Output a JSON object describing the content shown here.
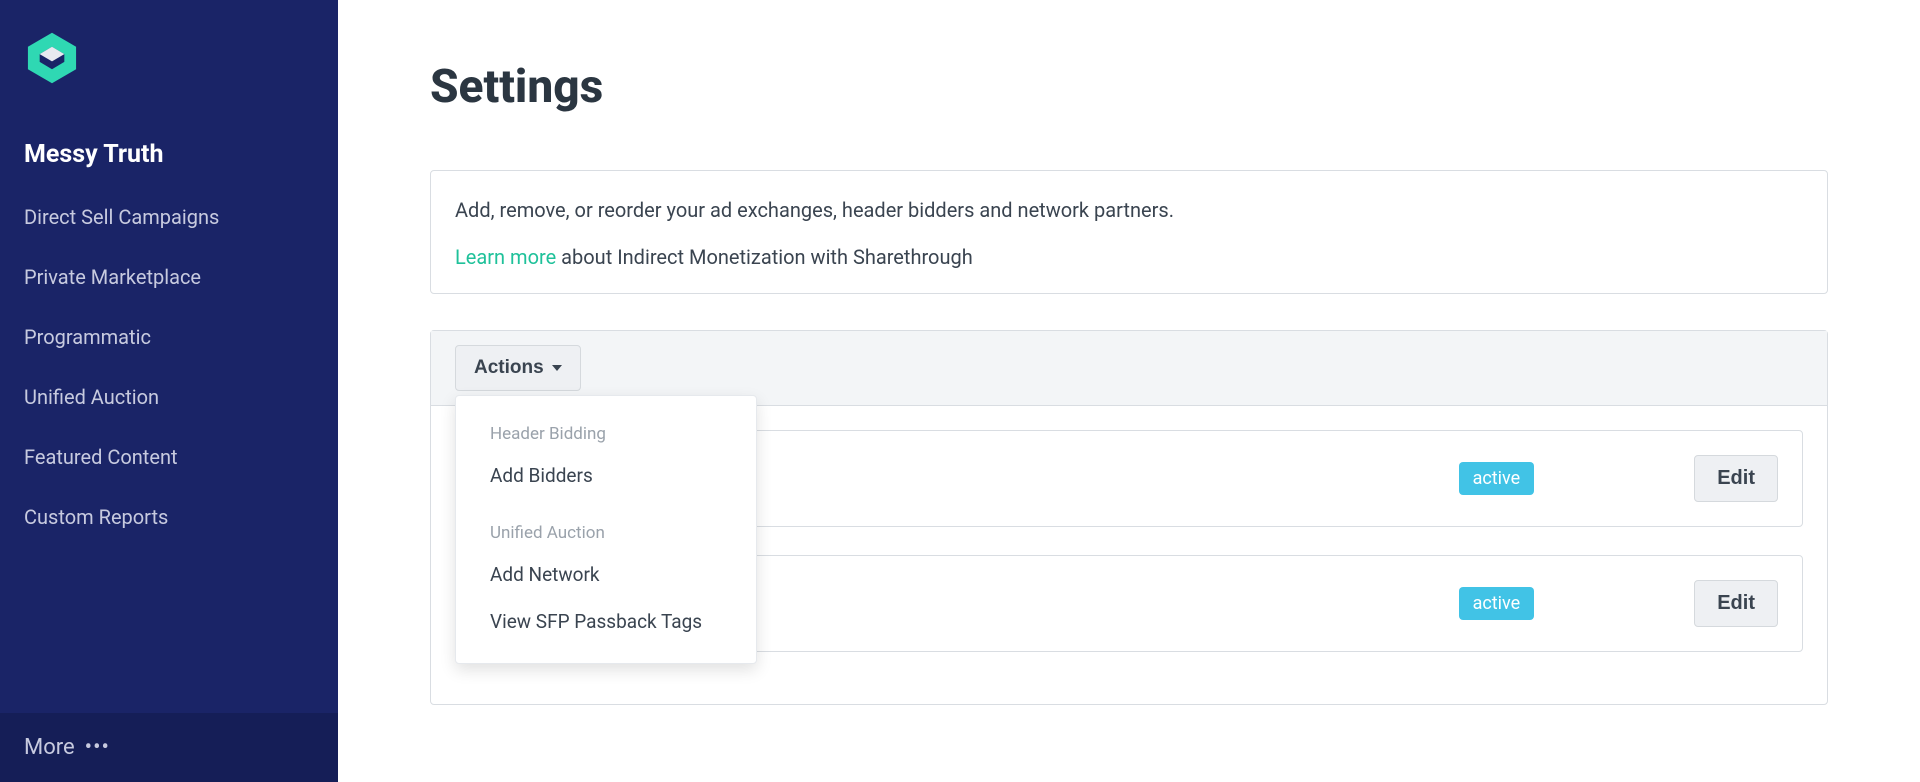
{
  "sidebar": {
    "account_name": "Messy Truth",
    "nav": [
      {
        "label": "Direct Sell Campaigns"
      },
      {
        "label": "Private Marketplace"
      },
      {
        "label": "Programmatic"
      },
      {
        "label": "Unified Auction"
      },
      {
        "label": "Featured Content"
      },
      {
        "label": "Custom Reports"
      }
    ],
    "more_label": "More"
  },
  "main": {
    "title": "Settings",
    "intro": {
      "line1": "Add, remove, or reorder your ad exchanges, header bidders and network partners.",
      "learn_more": "Learn more",
      "learn_more_rest": " about Indirect Monetization with Sharethrough"
    },
    "actions_button": "Actions",
    "dropdown": {
      "section1_label": "Header Bidding",
      "section1_items": [
        {
          "label": "Add Bidders"
        }
      ],
      "section2_label": "Unified Auction",
      "section2_items": [
        {
          "label": "Add Network"
        },
        {
          "label": "View SFP Passback Tags"
        }
      ]
    },
    "rows": [
      {
        "status": "active",
        "edit": "Edit"
      },
      {
        "status": "active",
        "edit": "Edit"
      }
    ]
  },
  "colors": {
    "sidebar_bg": "#1a2467",
    "accent": "#1fc19a",
    "status_badge": "#41c3e6"
  }
}
